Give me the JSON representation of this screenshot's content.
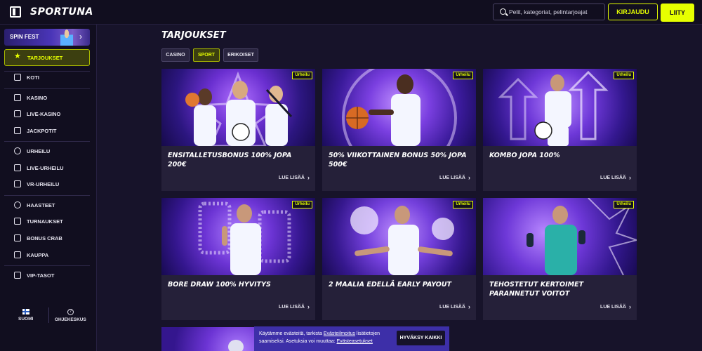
{
  "header": {
    "logo": "SPORTUNA",
    "search": {
      "placeholder": "Pelit, kategoriat, pelintarjoajat"
    },
    "login_label": "KIRJAUDU",
    "join_label": "LIITY"
  },
  "sidebar": {
    "promo_label": "SPIN FEST",
    "active_item": {
      "label": "TARJOUKSET",
      "icon": "star-icon"
    },
    "items": [
      {
        "label": "KOTI",
        "icon": "home-icon"
      },
      {
        "label": "KASINO",
        "icon": "slot-icon"
      },
      {
        "label": "LIVE-KASINO",
        "icon": "cards-icon"
      },
      {
        "label": "JACKPOTIT",
        "icon": "jackpot-icon"
      },
      {
        "label": "URHEILU",
        "icon": "ball-icon"
      },
      {
        "label": "LIVE-URHEILU",
        "icon": "live-icon"
      },
      {
        "label": "VR-URHEILU",
        "icon": "vr-icon"
      },
      {
        "label": "HAASTEET",
        "icon": "bulb-icon"
      },
      {
        "label": "TURNAUKSET",
        "icon": "trophy-icon"
      },
      {
        "label": "BONUS CRAB",
        "icon": "crab-icon"
      },
      {
        "label": "KAUPPA",
        "icon": "bag-icon"
      },
      {
        "label": "VIP-TASOT",
        "icon": "diamond-icon"
      }
    ],
    "language_label": "SUOMI",
    "help_label": "OHJEKESKUS"
  },
  "main": {
    "title": "TARJOUKSET",
    "tabs": [
      {
        "label": "CASINO",
        "active": false
      },
      {
        "label": "SPORT",
        "active": true
      },
      {
        "label": "ERIKOISET",
        "active": false
      }
    ],
    "cards": [
      {
        "badge": "Urheilu",
        "title": "ENSITALLETUSBONUS 100% JOPA 200€",
        "more": "LUE LISÄÄ"
      },
      {
        "badge": "Urheilu",
        "title": "50% VIIKOTTAINEN BONUS 50% JOPA 500€",
        "more": "LUE LISÄÄ"
      },
      {
        "badge": "Urheilu",
        "title": "KOMBO JOPA 100%",
        "more": "LUE LISÄÄ"
      },
      {
        "badge": "Urheilu",
        "title": "BORE DRAW 100% HYVITYS",
        "more": "LUE LISÄÄ"
      },
      {
        "badge": "Urheilu",
        "title": "2 MAALIA EDELLÄ EARLY PAYOUT",
        "more": "LUE LISÄÄ"
      },
      {
        "badge": "Urheilu",
        "title": "TEHOSTETUT KERTOIMET PARANNETUT VOITOT",
        "more": "LUE LISÄÄ"
      }
    ]
  },
  "cookie": {
    "text_1": "Käytämme evästeitä, tarkista ",
    "link_1": "Evästeilmoitus",
    "text_2": " lisätietojen saamiseksi. Asetuksia voi muuttaa: ",
    "link_2": "Evästeasetukset",
    "accept_label": "HYVÄKSY KAIKKI"
  },
  "colors": {
    "accent": "#e6ff00",
    "background": "#17132a",
    "card": "#252039",
    "cookie_bg": "#3d2fa8"
  }
}
